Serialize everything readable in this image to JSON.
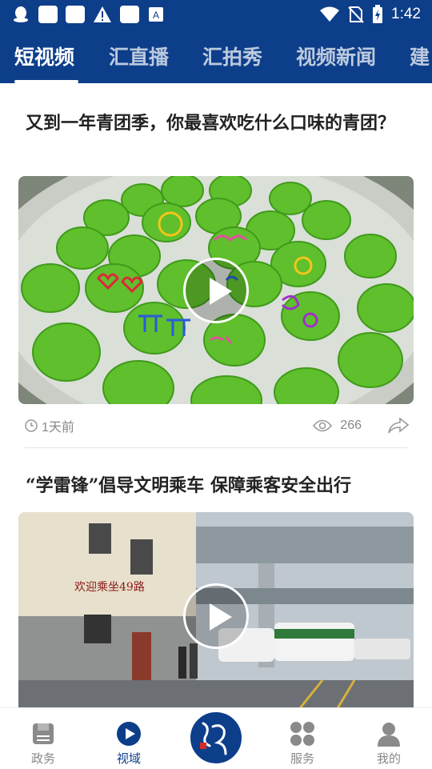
{
  "status_bar": {
    "time": "1:42",
    "left_icons": [
      "qq-icon",
      "app-icon",
      "app-icon",
      "warning-icon",
      "app-icon",
      "font-icon"
    ],
    "right_icons": [
      "wifi-icon",
      "no-sim-icon",
      "battery-charging-icon"
    ]
  },
  "tabs": [
    {
      "label": "短视频",
      "active": true
    },
    {
      "label": "汇直播",
      "active": false
    },
    {
      "label": "汇拍秀",
      "active": false
    },
    {
      "label": "视频新闻",
      "active": false
    },
    {
      "label": "建",
      "active": false
    }
  ],
  "feed": [
    {
      "title": "又到一年青团季，你最喜欢吃什么口味的青团？",
      "time": "1天前",
      "views": "266"
    },
    {
      "title": "“学雷锋”倡导文明乘车 保障乘客安全出行",
      "sign": "欢迎乘坐49路"
    }
  ],
  "bottom_nav": [
    {
      "label": "政务",
      "icon": "document-icon",
      "active": false
    },
    {
      "label": "视域",
      "icon": "play-circle-icon",
      "active": true
    },
    {
      "label": "服务",
      "icon": "grid-icon",
      "active": false
    },
    {
      "label": "我的",
      "icon": "user-icon",
      "active": false
    }
  ],
  "colors": {
    "brand": "#0d3e8a",
    "accent_text": "#222222",
    "meta_text": "#888888"
  }
}
